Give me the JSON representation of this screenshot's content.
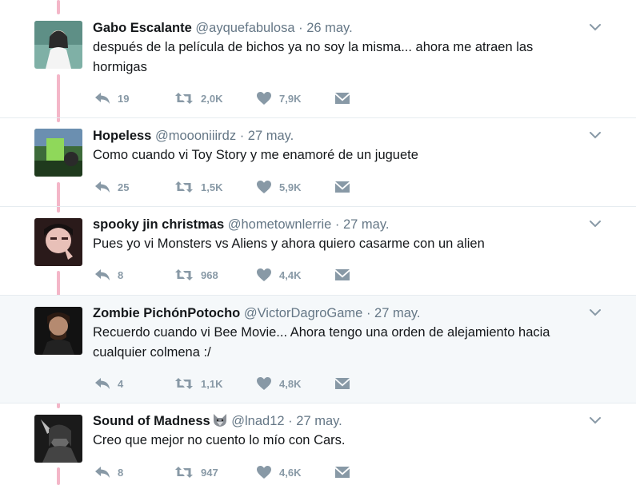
{
  "tweets": [
    {
      "name": "Gabo Escalante",
      "handle": "@ayquefabulosa",
      "separator": "·",
      "date": "26 may.",
      "text_lines": [
        "después de la película de bichos ya no soy la misma... ahora me atraen las",
        "hormigas"
      ],
      "replies": "19",
      "retweets": "2,0K",
      "likes": "7,9K",
      "avatar_icon": "profile-photo"
    },
    {
      "name": "Hopeless",
      "handle": "@moooniiirdz",
      "separator": "·",
      "date": "27 may.",
      "text_lines": [
        "Como cuando vi Toy Story y me enamoré de un juguete"
      ],
      "replies": "25",
      "retweets": "1,5K",
      "likes": "5,9K",
      "avatar_icon": "profile-photo"
    },
    {
      "name": "spooky jin christmas",
      "handle": "@hometownlerrie",
      "separator": "·",
      "date": "27 may.",
      "text_lines": [
        "Pues yo vi Monsters vs Aliens y ahora quiero casarme con un alien"
      ],
      "replies": "8",
      "retweets": "968",
      "likes": "4,4K",
      "avatar_icon": "profile-photo"
    },
    {
      "name": "Zombie PichónPotocho",
      "handle": "@VictorDagroGame",
      "separator": "·",
      "date": "27 may.",
      "text_lines": [
        "Recuerdo cuando vi Bee Movie... Ahora tengo una orden de alejamiento hacia",
        "cualquier colmena :/"
      ],
      "replies": "4",
      "retweets": "1,1K",
      "likes": "4,8K",
      "avatar_icon": "profile-photo"
    },
    {
      "name": "Sound of Madness",
      "name_emoji": "wolf-emoji",
      "handle": "@lnad12",
      "separator": "·",
      "date": "27 may.",
      "text_lines": [
        "Creo que mejor no cuento lo mío con Cars."
      ],
      "replies": "8",
      "retweets": "947",
      "likes": "4,6K",
      "avatar_icon": "profile-photo"
    }
  ],
  "colors": {
    "thread_line": "#f4b6c8",
    "action_icon": "#8899a6",
    "secondary_text": "#657786",
    "highlight_bg": "#f5f8fa"
  },
  "icons": [
    "reply-icon",
    "retweet-icon",
    "like-icon",
    "message-icon",
    "chevron-down-icon"
  ]
}
